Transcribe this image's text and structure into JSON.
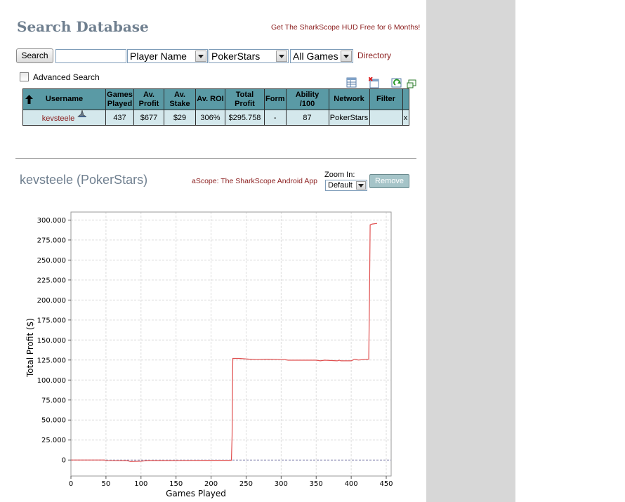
{
  "header": {
    "title": "Search Database",
    "hud_promo": "Get The SharkScope HUD Free for 6 Months!"
  },
  "search": {
    "button_label": "Search",
    "input_value": "",
    "field_select": "Player Name",
    "network_select": "PokerStars",
    "games_select": "All Games",
    "directory_link": "Directory",
    "advanced_label": "Advanced Search"
  },
  "table": {
    "columns": [
      "Username",
      "Games Played",
      "Av. Profit",
      "Av. Stake",
      "Av. ROI",
      "Total Profit",
      "Form",
      "Ability /100",
      "Network",
      "Filter"
    ],
    "row": {
      "username": "kevsteele",
      "games_played": "437",
      "av_profit": "$677",
      "av_stake": "$29",
      "av_roi": "306%",
      "total_profit": "$295.758",
      "form": "-",
      "ability": "87",
      "network": "PokerStars",
      "filter": "",
      "remove": "x"
    }
  },
  "player": {
    "heading": "kevsteele (PokerStars)",
    "ascope_promo": "aScope: The SharkScope Android App",
    "zoom_label": "Zoom In:",
    "zoom_value": "Default",
    "remove_label": "Remove"
  },
  "chart_data": {
    "type": "line",
    "title": "",
    "xlabel": "Games Played",
    "ylabel": "Total Profit ($)",
    "xlim": [
      0,
      457
    ],
    "ylim": [
      -20000,
      310000
    ],
    "x_ticks": [
      0,
      50,
      100,
      150,
      200,
      250,
      300,
      350,
      400,
      450
    ],
    "y_ticks": [
      0,
      25000,
      50000,
      75000,
      100000,
      125000,
      150000,
      175000,
      200000,
      225000,
      250000,
      275000,
      300000
    ],
    "y_tick_labels": [
      "0",
      "25.000",
      "50.000",
      "75.000",
      "100.000",
      "125.000",
      "150.000",
      "175.000",
      "200.000",
      "225.000",
      "250.000",
      "275.000",
      "300.000"
    ],
    "x_tick_labels": [
      "0",
      "50",
      "100",
      "150",
      "200",
      "250",
      "300",
      "350",
      "400",
      "450"
    ],
    "grid": true,
    "line_color": "#e05050",
    "series": [
      {
        "x": [
          0,
          48,
          50,
          80,
          85,
          100,
          110,
          130,
          200,
          229,
          230,
          231,
          240,
          255,
          265,
          280,
          300,
          305,
          310,
          350,
          356,
          362,
          380,
          383,
          385,
          400,
          405,
          410,
          425,
          426,
          427,
          430,
          437
        ],
        "y": [
          0,
          0,
          -500,
          -700,
          -1800,
          -1500,
          -600,
          -600,
          -300,
          -300,
          30000,
          127000,
          127000,
          126000,
          125500,
          126000,
          125500,
          125500,
          124800,
          124800,
          124000,
          124800,
          124000,
          124800,
          124000,
          124000,
          126000,
          125000,
          126000,
          200000,
          294000,
          295000,
          295758
        ]
      }
    ]
  }
}
